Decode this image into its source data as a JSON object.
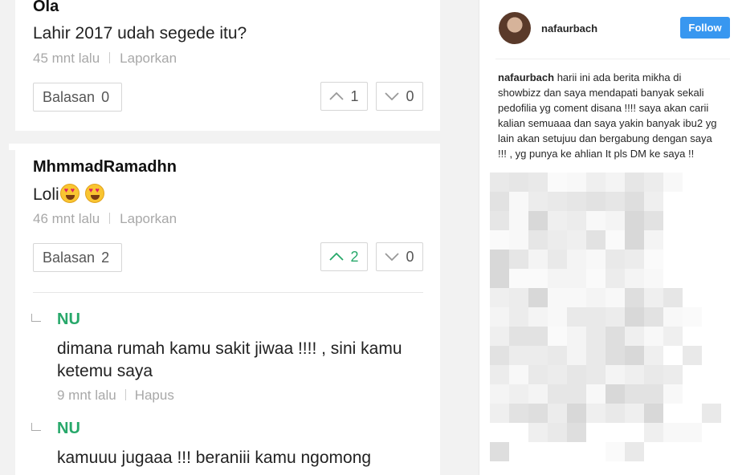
{
  "comments": [
    {
      "username": "Ola",
      "text": "Lahir 2017 udah segede itu?",
      "time": "45 mnt lalu",
      "report": "Laporkan",
      "reply_label": "Balasan",
      "reply_count": "0",
      "upvotes": "1",
      "downvotes": "0"
    },
    {
      "username": "MhmmadRamadhn",
      "text": "Loli",
      "time": "46 mnt lalu",
      "report": "Laporkan",
      "reply_label": "Balasan",
      "reply_count": "2",
      "upvotes": "2",
      "downvotes": "0",
      "replies": [
        {
          "username": "NU",
          "text": "dimana rumah kamu sakit jiwaa !!!! , sini kamu ketemu saya",
          "time": "9 mnt lalu",
          "action": "Hapus"
        },
        {
          "username": "NU",
          "text": "kamuuu jugaaa !!! beraniii kamu ngomong"
        }
      ]
    }
  ],
  "instagram": {
    "username": "nafaurbach",
    "follow_label": "Follow",
    "caption_user": "nafaurbach",
    "caption_text": "harii ini ada berita mikha di showbizz dan saya mendapati banyak sekali pedofilia yg coment disana !!!! saya akan carii kalian semuaaa dan saya yakin banyak ibu2 yg lain akan setujuu dan bergabung dengan saya !!! , yg punya ke ahlian It pls DM ke saya !!",
    "accent": "#3897f0"
  },
  "colors": {
    "green": "#27a86a",
    "meta_gray": "#a8a8a8"
  }
}
